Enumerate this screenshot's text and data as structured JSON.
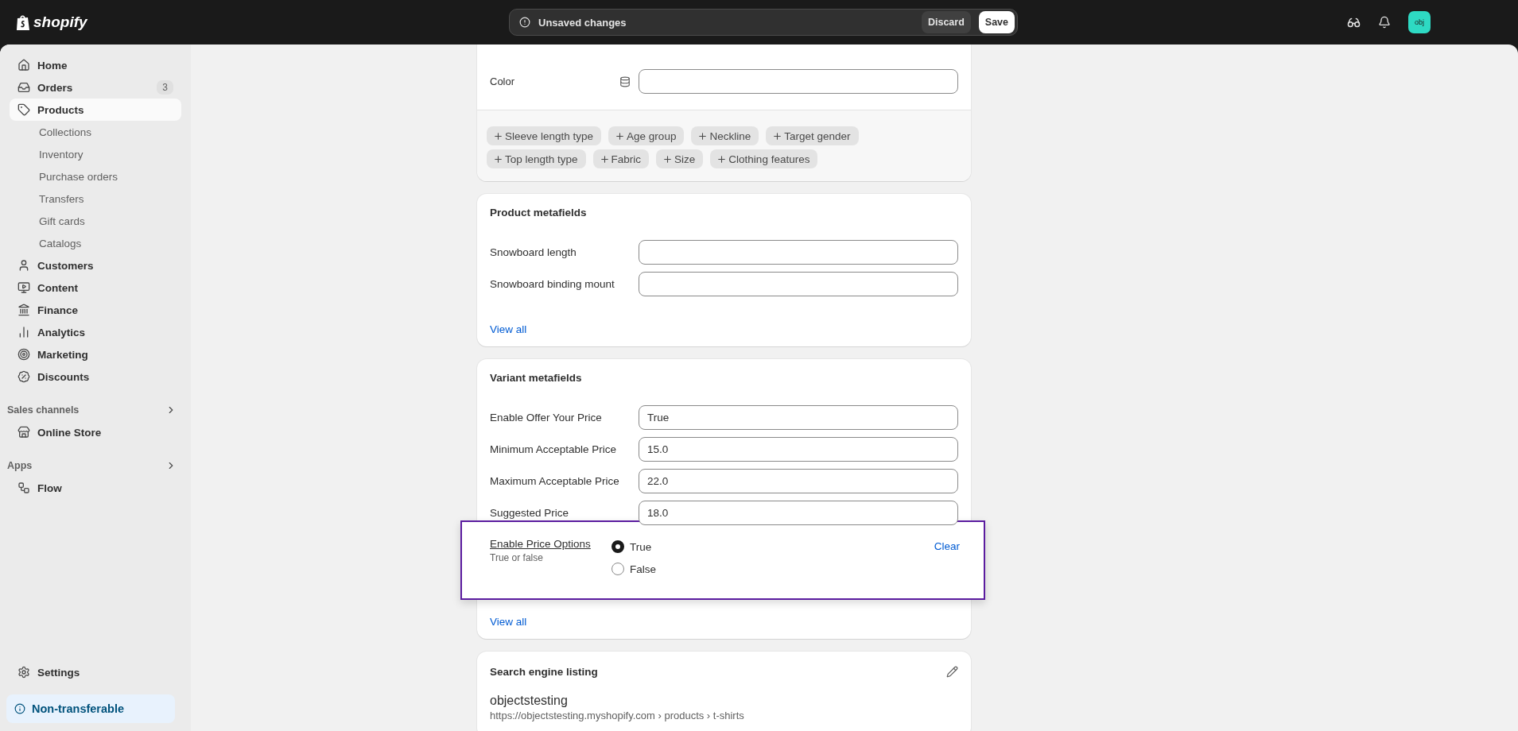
{
  "topbar": {
    "logo": "shopify",
    "unsaved": {
      "message": "Unsaved changes",
      "buttons": [
        {
          "label": "Discard",
          "kind": "secondary"
        },
        {
          "label": "Save",
          "kind": "primary"
        }
      ]
    },
    "avatar": "obj"
  },
  "sidebar": {
    "items": [
      {
        "label": "Home",
        "selected": false
      },
      {
        "label": "Orders",
        "selected": false,
        "badge": "3"
      },
      {
        "label": "Products",
        "selected": true,
        "children": [
          {
            "label": "Collections",
            "selected": false
          },
          {
            "label": "Inventory",
            "selected": false
          },
          {
            "label": "Purchase orders",
            "selected": false
          },
          {
            "label": "Transfers",
            "selected": false
          },
          {
            "label": "Gift cards",
            "selected": false
          },
          {
            "label": "Catalogs",
            "selected": false
          }
        ]
      },
      {
        "label": "Customers",
        "selected": false
      },
      {
        "label": "Content",
        "selected": false
      },
      {
        "label": "Finance",
        "selected": false
      },
      {
        "label": "Analytics",
        "selected": false
      },
      {
        "label": "Marketing",
        "selected": false
      },
      {
        "label": "Discounts",
        "selected": false
      }
    ],
    "sections": [
      {
        "title": "Sales channels",
        "items": [
          {
            "label": "Online Store",
            "selected": false
          }
        ]
      },
      {
        "title": "Apps",
        "items": [
          {
            "label": "Flow",
            "selected": false
          }
        ]
      }
    ],
    "settings": "Settings",
    "banner": "Non-transferable"
  },
  "category_card": {
    "fields": [
      {
        "label": "Color"
      }
    ],
    "chips": [
      "Sleeve length type",
      "Age group",
      "Neckline",
      "Target gender",
      "Top length type",
      "Fabric",
      "Size",
      "Clothing features"
    ]
  },
  "product_metafields": {
    "title": "Product metafields",
    "fields": [
      {
        "label": "Snowboard length"
      },
      {
        "label": "Snowboard binding mount"
      }
    ],
    "link": "View all"
  },
  "variant_metafields": {
    "title": "Variant metafields",
    "fields": [
      {
        "label": "Enable Offer Your Price",
        "value": "True"
      },
      {
        "label": "Minimum Acceptable Price",
        "value": "15.0"
      },
      {
        "label": "Maximum Acceptable Price",
        "value": "22.0"
      },
      {
        "label": "Suggested Price",
        "value": "18.0"
      }
    ],
    "editor": {
      "label": "Enable Price Options",
      "hint": "True or false",
      "options": [
        {
          "label": "True",
          "selected": true
        },
        {
          "label": "False",
          "selected": false
        }
      ],
      "clear": "Clear"
    },
    "link": "View all"
  },
  "seo": {
    "title": "Search engine listing",
    "page_title": "objectstesting",
    "url": "https://objectstesting.myshopify.com › products › t-shirts"
  }
}
